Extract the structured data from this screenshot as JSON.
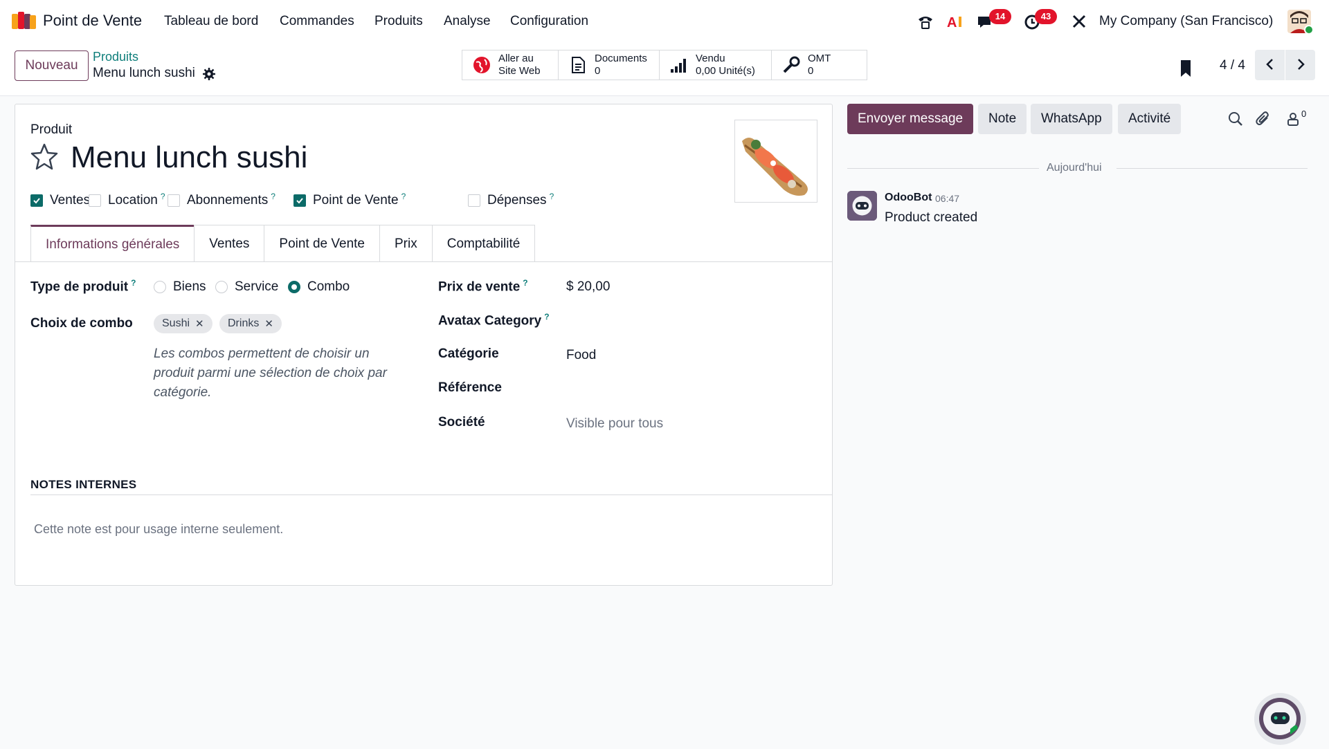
{
  "topbar": {
    "app_name": "Point de Vente",
    "menu": [
      "Tableau de bord",
      "Commandes",
      "Produits",
      "Analyse",
      "Configuration"
    ],
    "chat_badge": "14",
    "activity_badge": "43",
    "company": "My Company (San Francisco)"
  },
  "control": {
    "new_label": "Nouveau",
    "breadcrumb_parent": "Produits",
    "breadcrumb_current": "Menu lunch sushi",
    "smart_buttons": [
      {
        "line1": "Aller au",
        "line2": "Site Web"
      },
      {
        "line1": "Documents",
        "line2": "0"
      },
      {
        "line1": "Vendu",
        "line2": "0,00 Unité(s)"
      },
      {
        "line1": "OMT",
        "line2": "0"
      }
    ],
    "pager": "4 / 4"
  },
  "form": {
    "label": "Produit",
    "title": "Menu lunch sushi",
    "checkboxes": [
      {
        "label": "Ventes",
        "checked": true,
        "help": ""
      },
      {
        "label": "Location",
        "checked": false,
        "help": "?"
      },
      {
        "label": "Abonnements",
        "checked": false,
        "help": "?"
      },
      {
        "label": "Point de Vente",
        "checked": true,
        "help": "?"
      },
      {
        "label": "Dépenses",
        "checked": false,
        "help": "?"
      }
    ],
    "tabs": [
      "Informations générales",
      "Ventes",
      "Point de Vente",
      "Prix",
      "Comptabilité"
    ],
    "product_type_label": "Type de produit",
    "product_type_options": [
      "Biens",
      "Service",
      "Combo"
    ],
    "product_type_selected": "Combo",
    "combo_label": "Choix de combo",
    "combo_tags": [
      "Sushi",
      "Drinks"
    ],
    "combo_help": "Les combos permettent de choisir un produit parmi une sélection de choix par catégorie.",
    "price_label": "Prix de vente",
    "price_value": "$ 20,00",
    "avatax_label": "Avatax Category",
    "category_label": "Catégorie",
    "category_value": "Food",
    "reference_label": "Référence",
    "company_label": "Société",
    "company_placeholder": "Visible pour tous",
    "notes_heading": "NOTES INTERNES",
    "notes_placeholder": "Cette note est pour usage interne seulement."
  },
  "chatter": {
    "buttons": [
      "Envoyer message",
      "Note",
      "WhatsApp",
      "Activité"
    ],
    "followers": "0",
    "today": "Aujourd'hui",
    "author": "OdooBot",
    "time": "06:47",
    "message": "Product created"
  },
  "colors": {
    "primary": "#6d3b5a",
    "accent": "#0e7e7a",
    "badge": "#e2142b"
  }
}
